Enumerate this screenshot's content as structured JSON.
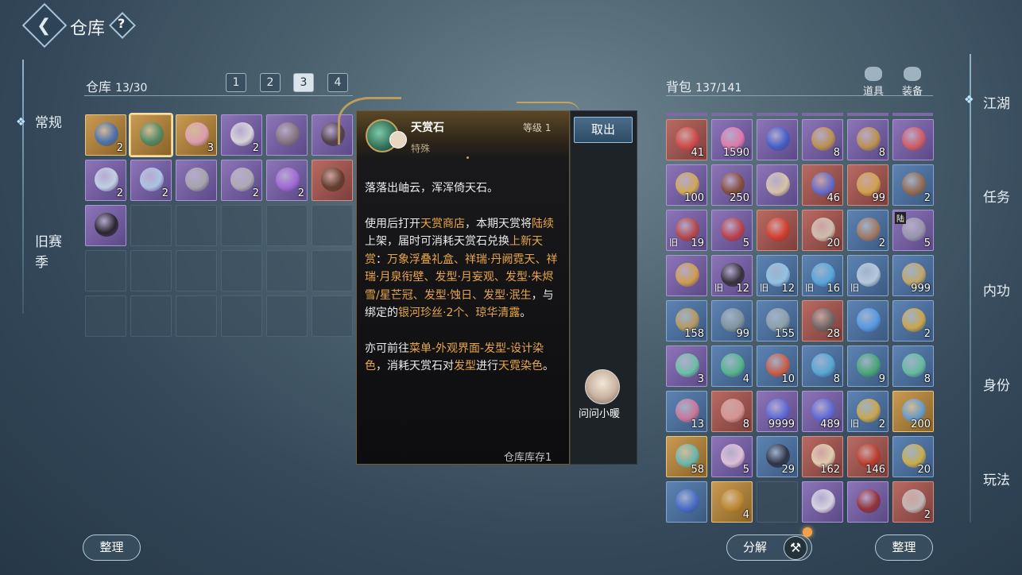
{
  "header": {
    "title": "仓库",
    "help": "?"
  },
  "left_nav": [
    {
      "label": "常规",
      "active": true
    },
    {
      "label": "旧赛季",
      "active": false
    }
  ],
  "right_nav": [
    {
      "label": "江湖",
      "active": true
    },
    {
      "label": "任务"
    },
    {
      "label": "内功"
    },
    {
      "label": "身份"
    },
    {
      "label": "玩法"
    }
  ],
  "warehouse": {
    "label": "仓库",
    "capacity": "13/30",
    "page_tabs": [
      "1",
      "2",
      "3",
      "4"
    ],
    "active_page": "3",
    "items": [
      {
        "q": "gold",
        "icon": "blue-card-icon",
        "qty": "2",
        "color": "#3b6fc2"
      },
      {
        "q": "gold",
        "icon": "heavenly-stone-icon",
        "qty": "",
        "selected": true,
        "color": "#3f8d6b"
      },
      {
        "q": "gold",
        "icon": "pink-gem-icon",
        "qty": "3",
        "color": "#e7a3c4"
      },
      {
        "q": "purple",
        "icon": "white-robe-icon",
        "qty": "2",
        "color": "#e8e8e8"
      },
      {
        "q": "purple",
        "icon": "grey-robe-icon",
        "qty": "",
        "color": "#8a7a7a"
      },
      {
        "q": "purple",
        "icon": "dark-outfit-icon",
        "qty": "",
        "color": "#4d3b3b"
      },
      {
        "q": "purple",
        "icon": "female-outfit-icon",
        "qty": "2",
        "color": "#cfe4f2"
      },
      {
        "q": "purple",
        "icon": "blue-dress-icon",
        "qty": "2",
        "color": "#b6d6f0"
      },
      {
        "q": "purple",
        "icon": "silver-armor-icon",
        "qty": "",
        "color": "#b0b0b0"
      },
      {
        "q": "purple",
        "icon": "silver-armor-icon",
        "qty": "2",
        "color": "#b8b8b8"
      },
      {
        "q": "purple",
        "icon": "purple-ticket-icon",
        "qty": "2",
        "color": "#a86de0"
      },
      {
        "q": "red",
        "icon": "dark-figure-icon",
        "qty": "",
        "color": "#5a3a2a"
      },
      {
        "q": "purple",
        "icon": "black-ore-icon",
        "qty": "",
        "color": "#1d1d1d"
      }
    ],
    "sort_label": "整理"
  },
  "tooltip": {
    "name": "天赏石",
    "type": "特殊",
    "level": "等级 1",
    "take_out": "取出",
    "npc_label": "问问小暖",
    "stock": "仓库库存1",
    "p1": "落落出岫云，浑浑倚天石。",
    "p2": [
      {
        "t": "使用后打开"
      },
      {
        "t": "天赏商店",
        "h": true
      },
      {
        "t": "，本期天赏将"
      },
      {
        "t": "陆续",
        "h": true
      },
      {
        "t": "上架，届时可消耗天赏石兑换"
      },
      {
        "t": "上新天赏",
        "h": true
      },
      {
        "t": "："
      },
      {
        "t": "万象浮叠礼盒、祥瑞·丹阙霓天、祥瑞·月泉衔壁、发型·月妄观、发型·朱烬雪/星芒冠、发型·蚀日、发型·泯生",
        "h": true
      },
      {
        "t": "，与绑定的"
      },
      {
        "t": "银河珍丝·2个、琼华清露",
        "h": true
      },
      {
        "t": "。"
      }
    ],
    "p3": [
      {
        "t": "亦可前往"
      },
      {
        "t": "菜单-外观界面-发型-设计染色",
        "h": true
      },
      {
        "t": "，消耗天赏石对"
      },
      {
        "t": "发型",
        "h": true
      },
      {
        "t": "进行"
      },
      {
        "t": "天霓染色",
        "h": true
      },
      {
        "t": "。"
      }
    ]
  },
  "bag": {
    "label": "背包",
    "capacity": "137/141",
    "tabs": [
      {
        "label": "道具",
        "icon": "props-icon"
      },
      {
        "label": "装备",
        "icon": "equipment-icon"
      }
    ],
    "items": [
      {
        "q": "red",
        "icon": "red-envelope-icon",
        "qty": "41",
        "color": "#d84a4a"
      },
      {
        "q": "purple",
        "icon": "pink-pearl-icon",
        "qty": "1590",
        "color": "#f07fae"
      },
      {
        "q": "purple",
        "icon": "blue-ticket-icon",
        "qty": "",
        "color": "#3d5fd0"
      },
      {
        "q": "purple",
        "icon": "gold-token-icon",
        "qty": "8",
        "color": "#c89a44"
      },
      {
        "q": "purple",
        "icon": "gold-token-icon",
        "qty": "8",
        "color": "#c89a44"
      },
      {
        "q": "purple",
        "icon": "red-pouch-icon",
        "qty": "",
        "color": "#e05c5c"
      },
      {
        "q": "purple",
        "icon": "gold-flower-icon",
        "qty": "100",
        "color": "#e0b64a"
      },
      {
        "q": "purple",
        "icon": "treasure-chest-icon",
        "qty": "250",
        "color": "#8a4a2a"
      },
      {
        "q": "purple",
        "icon": "scroll-icon",
        "qty": "",
        "color": "#e8d6a8"
      },
      {
        "q": "red",
        "icon": "blue-eye-orb-icon",
        "qty": "46",
        "color": "#5b6ee0"
      },
      {
        "q": "red",
        "icon": "gold-horn-icon",
        "qty": "99",
        "color": "#d9b14e"
      },
      {
        "q": "blue",
        "icon": "wood-bundle-icon",
        "qty": "2",
        "color": "#a06a45"
      },
      {
        "q": "purple",
        "icon": "red-seal-icon",
        "qty": "19",
        "old": "旧",
        "color": "#c0443c"
      },
      {
        "q": "purple",
        "icon": "red-ribbon-icon",
        "qty": "5",
        "color": "#c83c3c"
      },
      {
        "q": "red",
        "icon": "red-book-icon",
        "qty": "",
        "color": "#e03a2a"
      },
      {
        "q": "red",
        "icon": "rice-bowl-icon",
        "qty": "20",
        "color": "#d8cfc0"
      },
      {
        "q": "blue",
        "icon": "dumpling-icon",
        "qty": "2",
        "color": "#b07a5a"
      },
      {
        "q": "purple",
        "icon": "helmet-icon",
        "qty": "5",
        "tag": "陆",
        "color": "#a0a0b0"
      },
      {
        "q": "purple",
        "icon": "colorful-map-icon",
        "qty": "",
        "color": "#e0a840"
      },
      {
        "q": "purple",
        "icon": "black-rock-icon",
        "qty": "12",
        "old": "旧",
        "color": "#2a2a2a"
      },
      {
        "q": "blue",
        "icon": "ice-crystal-icon",
        "qty": "12",
        "old": "旧",
        "color": "#9fd0f0"
      },
      {
        "q": "blue",
        "icon": "blue-swirl-icon",
        "qty": "16",
        "old": "旧",
        "color": "#5ab0e8"
      },
      {
        "q": "blue",
        "icon": "silver-shard-icon",
        "qty": "",
        "old": "旧",
        "color": "#c8d8e8"
      },
      {
        "q": "blue",
        "icon": "gold-coin-icon",
        "qty": "999",
        "color": "#d8b060"
      },
      {
        "q": "blue",
        "icon": "gold-coin-icon",
        "qty": "158",
        "color": "#c8a058"
      },
      {
        "q": "blue",
        "icon": "grey-ore-icon",
        "qty": "99",
        "color": "#8a9aa0"
      },
      {
        "q": "blue",
        "icon": "grey-ore-icon",
        "qty": "155",
        "color": "#98a8ae"
      },
      {
        "q": "red",
        "icon": "dark-ore-icon",
        "qty": "28",
        "color": "#6a6a6a"
      },
      {
        "q": "blue",
        "icon": "blue-feather-icon",
        "qty": "",
        "color": "#5aa0f0"
      },
      {
        "q": "blue",
        "icon": "gold-bead-icon",
        "qty": "2",
        "color": "#e0b040"
      },
      {
        "q": "purple",
        "icon": "jade-hook-icon",
        "qty": "3",
        "color": "#6ad0a8"
      },
      {
        "q": "blue",
        "icon": "jade-hook-icon",
        "qty": "4",
        "color": "#5ac08a"
      },
      {
        "q": "blue",
        "icon": "red-hook-icon",
        "qty": "10",
        "color": "#e05a3a"
      },
      {
        "q": "blue",
        "icon": "blue-hook-icon",
        "qty": "8",
        "color": "#5ab0e0"
      },
      {
        "q": "blue",
        "icon": "green-hook-icon",
        "qty": "9",
        "color": "#4ab070"
      },
      {
        "q": "blue",
        "icon": "jade-hook-icon",
        "qty": "8",
        "color": "#6ac8a0"
      },
      {
        "q": "blue",
        "icon": "pink-hook-icon",
        "qty": "13",
        "color": "#e07a9a"
      },
      {
        "q": "red",
        "icon": "red-talisman-icon",
        "qty": "8",
        "color": "#e0a0a0"
      },
      {
        "q": "purple",
        "icon": "purple-eye-orb-icon",
        "qty": "9999",
        "color": "#5a6ae0"
      },
      {
        "q": "purple",
        "icon": "purple-eye-orb-icon",
        "qty": "489",
        "color": "#5a6ae0"
      },
      {
        "q": "blue",
        "icon": "gold-lantern-icon",
        "qty": "2",
        "old": "旧",
        "color": "#e0b040"
      },
      {
        "q": "gold",
        "icon": "gift-box-icon",
        "qty": "200",
        "color": "#5aa0e0"
      },
      {
        "q": "gold",
        "icon": "jade-plate-icon",
        "qty": "58",
        "color": "#60c0c0"
      },
      {
        "q": "purple",
        "icon": "crystal-ball-icon",
        "qty": "5",
        "color": "#f0d0e0"
      },
      {
        "q": "blue",
        "icon": "figurine-icon",
        "qty": "29",
        "color": "#2a2a3a"
      },
      {
        "q": "red",
        "icon": "paper-crane-icon",
        "qty": "162",
        "color": "#f0e0c0"
      },
      {
        "q": "red",
        "icon": "red-drum-icon",
        "qty": "146",
        "color": "#c03a2a"
      },
      {
        "q": "blue",
        "icon": "gold-egg-icon",
        "qty": "20",
        "color": "#e0b840"
      },
      {
        "q": "blue",
        "icon": "blue-bracelet-icon",
        "qty": "",
        "color": "#4a6ad0"
      },
      {
        "q": "gold",
        "icon": "gold-casket-icon",
        "qty": "4",
        "color": "#c08a30"
      },
      {
        "q": "empty",
        "icon": "",
        "qty": "",
        "color": ""
      },
      {
        "q": "purple",
        "icon": "snowman-ticket-icon",
        "qty": "",
        "color": "#e8e8f0"
      },
      {
        "q": "purple",
        "icon": "red-armor-icon",
        "qty": "",
        "color": "#9a2a2a"
      },
      {
        "q": "red",
        "icon": "silver-ingot-icon",
        "qty": "2",
        "color": "#c8c8c8"
      }
    ],
    "decompose_label": "分解",
    "sort_label": "整理"
  }
}
